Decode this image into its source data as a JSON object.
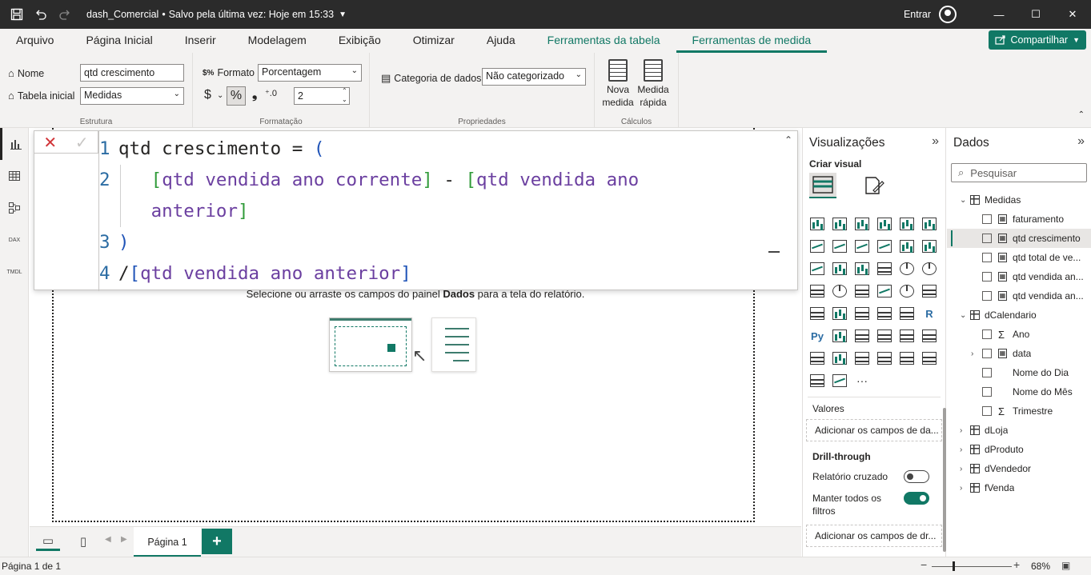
{
  "titlebar": {
    "file_name": "dash_Comercial",
    "saved_status": "Salvo pela última vez: Hoje em 15:33",
    "sign_in": "Entrar"
  },
  "menu": {
    "items": [
      "Arquivo",
      "Página Inicial",
      "Inserir",
      "Modelagem",
      "Exibição",
      "Otimizar",
      "Ajuda"
    ],
    "context_table": "Ferramentas da tabela",
    "context_measure": "Ferramentas de medida",
    "share": "Compartilhar"
  },
  "ribbon": {
    "name_label": "Nome",
    "name_value": "qtd crescimento",
    "home_table_label": "Tabela inicial",
    "home_table_value": "Medidas",
    "group_structure": "Estrutura",
    "format_label": "Formato",
    "format_value": "Porcentagem",
    "currency_symbol": "$",
    "percent_symbol": "%",
    "comma_symbol": "❟",
    "decimals_value": "2",
    "group_format": "Formatação",
    "category_label": "Categoria de dados",
    "category_value": "Não categorizado",
    "group_properties": "Propriedades",
    "new_measure_label": "Nova medida",
    "quick_measure_label": "Medida rápida",
    "group_calcs": "Cálculos"
  },
  "formula": {
    "lines": [
      {
        "num": "1",
        "text": "qtd crescimento = ("
      },
      {
        "num": "2",
        "text": "[qtd vendida ano corrente] - [qtd vendida ano"
      },
      {
        "num": "",
        "text": "anterior]"
      },
      {
        "num": "3",
        "text": ")"
      },
      {
        "num": "4",
        "text": "/[qtd vendida ano anterior]"
      }
    ],
    "line1_name": "qtd crescimento",
    "line1_op": " = ",
    "line1_paren": "(",
    "line2_col1": "qtd vendida ano corrente",
    "line2_minus": " - ",
    "line2_col2": "qtd vendida ano",
    "line2b_col": "anterior",
    "line3_paren": ")",
    "line4_slash": "/",
    "line4_col": "qtd vendida ano anterior"
  },
  "canvas": {
    "empty_prefix": "Selecione ou arraste os campos do painel ",
    "empty_bold": "Dados",
    "empty_suffix": " para a tela do relatório."
  },
  "pages": {
    "tab": "Página 1",
    "add": "+"
  },
  "status": {
    "page_of": "Página 1 de 1",
    "zoom": "68%",
    "zoom_level": 0.68
  },
  "viz": {
    "title": "Visualizações",
    "build": "Criar visual",
    "values_label": "Valores",
    "values_drop": "Adicionar os campos de da...",
    "drill_label": "Drill-through",
    "cross_report": "Relatório cruzado",
    "keep_filters": "Manter todos os filtros",
    "drill_drop": "Adicionar os campos de dr...",
    "r_label": "R",
    "py_label": "Py",
    "more": "···"
  },
  "data": {
    "title": "Dados",
    "search_placeholder": "Pesquisar",
    "tree": [
      {
        "label": "Medidas",
        "level": 0,
        "kind": "table",
        "expanded": true
      },
      {
        "label": "faturamento",
        "level": 1,
        "kind": "measure"
      },
      {
        "label": "qtd crescimento",
        "level": 1,
        "kind": "measure",
        "selected": true
      },
      {
        "label": "qtd total de ve...",
        "level": 1,
        "kind": "measure"
      },
      {
        "label": "qtd vendida an...",
        "level": 1,
        "kind": "measure"
      },
      {
        "label": "qtd vendida an...",
        "level": 1,
        "kind": "measure"
      },
      {
        "label": "dCalendario",
        "level": 0,
        "kind": "table",
        "expanded": true
      },
      {
        "label": "Ano",
        "level": 1,
        "kind": "sum"
      },
      {
        "label": "data",
        "level": 1,
        "kind": "date"
      },
      {
        "label": "Nome do Dia",
        "level": 1,
        "kind": "text"
      },
      {
        "label": "Nome do Mês",
        "level": 1,
        "kind": "text"
      },
      {
        "label": "Trimestre",
        "level": 1,
        "kind": "sum"
      },
      {
        "label": "dLoja",
        "level": 0,
        "kind": "table"
      },
      {
        "label": "dProduto",
        "level": 0,
        "kind": "table"
      },
      {
        "label": "dVendedor",
        "level": 0,
        "kind": "table"
      },
      {
        "label": "fVenda",
        "level": 0,
        "kind": "table"
      }
    ]
  },
  "colors": {
    "accent": "#117865",
    "titlebar": "#2b2b2b",
    "dax_keyword": "#1f53b7",
    "dax_column": "#6b3fa0",
    "dax_bracket": "#319b3a"
  }
}
